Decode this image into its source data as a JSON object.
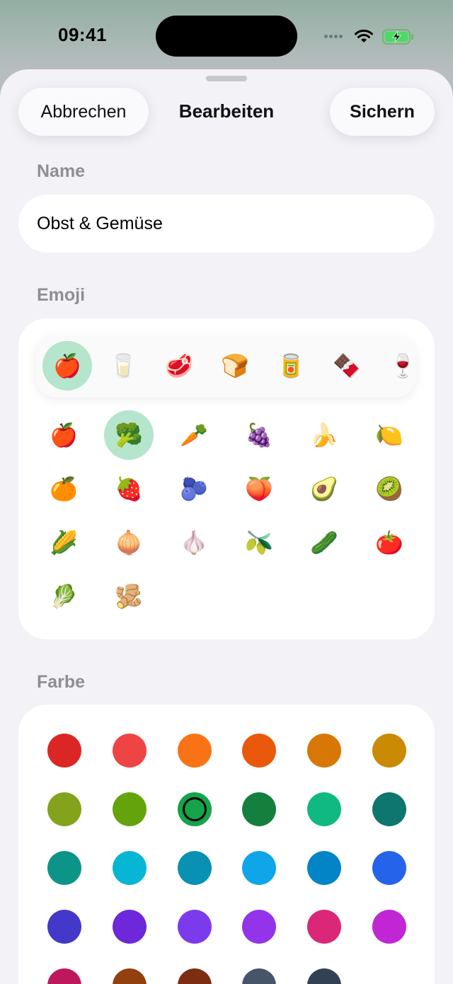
{
  "status_bar": {
    "time": "09:41"
  },
  "header": {
    "cancel_label": "Abbrechen",
    "title": "Bearbeiten",
    "save_label": "Sichern"
  },
  "name_section": {
    "label": "Name",
    "value": "Obst & Gemüse"
  },
  "emoji_section": {
    "label": "Emoji",
    "categories": [
      "🍎",
      "🥛",
      "🥩",
      "🍞",
      "🥫",
      "🍫",
      "🍷"
    ],
    "selected_category_index": 0,
    "emojis": [
      "🍎",
      "🥦",
      "🥕",
      "🍇",
      "🍌",
      "🍋",
      "🍊",
      "🍓",
      "🫐",
      "🍑",
      "🥑",
      "🥝",
      "🌽",
      "🧅",
      "🧄",
      "🫒",
      "🥒",
      "🍅",
      "🥬",
      "🫚"
    ],
    "selected_emoji_index": 1
  },
  "color_section": {
    "label": "Farbe",
    "colors": [
      "#dc2626",
      "#ef4444",
      "#f97316",
      "#ea580c",
      "#d97706",
      "#ca8a04",
      "#84a31c",
      "#65a30d",
      "#16a34a",
      "#15803d",
      "#10b981",
      "#0f766e",
      "#0d9488",
      "#06b6d4",
      "#0891b2",
      "#0ea5e9",
      "#0284c7",
      "#2563eb",
      "#4338ca",
      "#6d28d9",
      "#7c3aed",
      "#9333ea",
      "#db2777",
      "#c026d3",
      "#be185d",
      "#92400e",
      "#7c2d12",
      "#475569",
      "#334155"
    ],
    "selected_color_index": 8
  }
}
